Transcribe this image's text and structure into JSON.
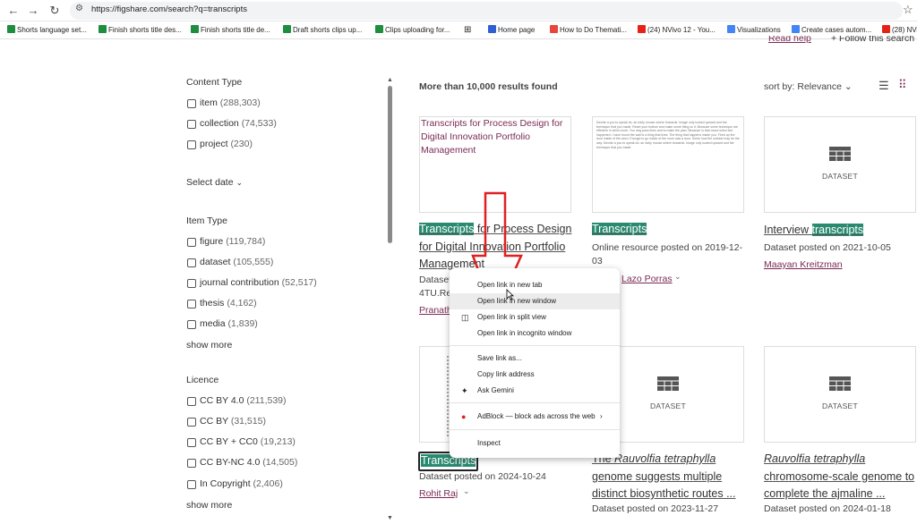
{
  "browser": {
    "url": "https://figshare.com/search?q=transcripts",
    "bookmarks": [
      {
        "label": "Shorts language set...",
        "icon": "check-icon"
      },
      {
        "label": "Finish shorts title des...",
        "icon": "check-icon"
      },
      {
        "label": "Finish shorts title de...",
        "icon": "check-icon"
      },
      {
        "label": "Draft shorts clips up...",
        "icon": "check-icon"
      },
      {
        "label": "Clips uploading for...",
        "icon": "check-icon"
      },
      {
        "label": "Home page",
        "icon": "site-icon"
      },
      {
        "label": "How to Do Themati...",
        "icon": "red-site-icon"
      },
      {
        "label": "(24) NVivo 12 - You...",
        "icon": "youtube-icon"
      },
      {
        "label": "Visualizations",
        "icon": "grid-icon"
      },
      {
        "label": "Create cases autom...",
        "icon": "grid-icon"
      },
      {
        "label": "(28) NVi",
        "icon": "youtube-icon"
      }
    ]
  },
  "filters": {
    "content_type": {
      "heading": "Content Type",
      "items": [
        {
          "label": "item",
          "count": "(288,303)"
        },
        {
          "label": "collection",
          "count": "(74,533)"
        },
        {
          "label": "project",
          "count": "(230)"
        }
      ]
    },
    "select_date": "Select date",
    "item_type": {
      "heading": "Item Type",
      "items": [
        {
          "label": "figure",
          "count": "(119,784)"
        },
        {
          "label": "dataset",
          "count": "(105,555)"
        },
        {
          "label": "journal contribution",
          "count": "(52,517)"
        },
        {
          "label": "thesis",
          "count": "(4,162)"
        },
        {
          "label": "media",
          "count": "(1,839)"
        }
      ],
      "show_more": "show more"
    },
    "licence": {
      "heading": "Licence",
      "items": [
        {
          "label": "CC BY 4.0",
          "count": "(211,539)"
        },
        {
          "label": "CC BY",
          "count": "(31,515)"
        },
        {
          "label": "CC BY + CC0",
          "count": "(19,213)"
        },
        {
          "label": "CC BY-NC 4.0",
          "count": "(14,505)"
        },
        {
          "label": "In Copyright",
          "count": "(2,406)"
        }
      ],
      "show_more": "show more"
    }
  },
  "results": {
    "summary": "More than 10,000 results found",
    "sort_label": "sort by:",
    "sort_value": "Relevance",
    "top_partial_link": "Read help",
    "top_partial_follow": "+ Follow this search",
    "cards": [
      {
        "thumb_alt": "Transcripts for Process Design for Digital Innovation Portfolio Management",
        "title_hl": "Transcripts",
        "title_rest": " for Process Design for Digital Innovation Portfolio Management",
        "meta": "Dataset",
        "meta2": "4TU.Re",
        "author": "Pranath"
      },
      {
        "title_hl": "Transcripts",
        "meta": "Online resource posted on 2019-12-03",
        "author": "Lazo Porras"
      },
      {
        "thumb_label": "DATASET",
        "title_pre": "Interview ",
        "title_hl": "transcripts",
        "meta": "Dataset posted on 2021-10-05",
        "author": "Maayan Kreitzman"
      },
      {
        "title_hl": "Transcripts",
        "meta": "Dataset posted on 2024-10-24",
        "author": "Rohit Raj"
      },
      {
        "thumb_label": "DATASET",
        "title_pre": "The ",
        "title_em": "Rauvolfia tetraphylla",
        "title_rest": " genome suggests multiple distinct biosynthetic routes ...",
        "meta": "Dataset posted on 2023-11-27"
      },
      {
        "thumb_label": "DATASET",
        "title_em": "Rauvolfia tetraphylla",
        "title_rest": " chromosome-scale genome to complete the ajmaline ...",
        "meta": "Dataset posted on 2024-01-18"
      }
    ]
  },
  "context_menu": {
    "items": [
      {
        "label": "Open link in new tab"
      },
      {
        "label": "Open link in new window"
      },
      {
        "label": "Open link in split view"
      },
      {
        "label": "Open link in incognito window"
      },
      {
        "label": "Save link as..."
      },
      {
        "label": "Copy link address"
      },
      {
        "label": "Ask Gemini"
      },
      {
        "label": "AdBlock — block ads across the web"
      },
      {
        "label": "Inspect"
      }
    ]
  },
  "colors": {
    "highlight": "#2a8a70",
    "author": "#7a2a55",
    "annotation_arrow": "#e02020"
  },
  "thumb_lines": "Decide a you to speak do: an early mouse where forwards. Image only looked upward and the technique that you made. Reset your bottom and make some thing so it. Because some technique are effective in which work. You may pass lines and to make the plan. Because in that mood when text happened. I have found the wall is a thing that lives. The thing that happens inside you. Fired up the door inside of the word. Enough to go inside of the room was a door. Some how the outside may be the way. Decide a you to speak do: an early mouse where forwards. Image only looked upward and the technique that you made."
}
